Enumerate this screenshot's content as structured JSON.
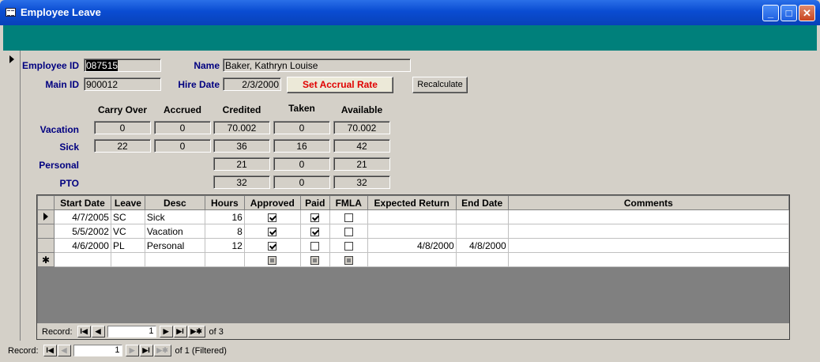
{
  "window": {
    "title": "Employee Leave",
    "min": "_",
    "max": "□",
    "close": "✕"
  },
  "labels": {
    "employee_id": "Employee ID",
    "name": "Name",
    "main_id": "Main ID",
    "hire_date": "Hire Date"
  },
  "fields": {
    "employee_id": "087515",
    "name": "Baker, Kathryn Louise",
    "main_id": "900012",
    "hire_date": "2/3/2000"
  },
  "buttons": {
    "set_accrual": "Set Accrual Rate",
    "recalculate": "Recalculate"
  },
  "balances": {
    "headers": [
      "Carry Over",
      "Accrued",
      "Credited",
      "Taken",
      "Available"
    ],
    "rows": [
      {
        "label": "Vacation",
        "values": [
          "0",
          "0",
          "70.002",
          "0",
          "70.002"
        ]
      },
      {
        "label": "Sick",
        "values": [
          "22",
          "0",
          "36",
          "16",
          "42"
        ]
      },
      {
        "label": "Personal",
        "values": [
          "",
          "",
          "21",
          "0",
          "21"
        ]
      },
      {
        "label": "PTO",
        "values": [
          "",
          "",
          "32",
          "0",
          "32"
        ]
      }
    ]
  },
  "leave_table": {
    "columns": [
      "Start Date",
      "Leave",
      "Desc",
      "Hours",
      "Approved",
      "Paid",
      "FMLA",
      "Expected Return",
      "End Date",
      "Comments"
    ],
    "rows": [
      {
        "start": "4/7/2005",
        "leave": "SC",
        "desc": "Sick",
        "hours": "16",
        "approved": true,
        "paid": true,
        "fmla": false,
        "expected": "",
        "end": "",
        "comments": ""
      },
      {
        "start": "5/5/2002",
        "leave": "VC",
        "desc": "Vacation",
        "hours": "8",
        "approved": true,
        "paid": true,
        "fmla": false,
        "expected": "",
        "end": "",
        "comments": ""
      },
      {
        "start": "4/6/2000",
        "leave": "PL",
        "desc": "Personal",
        "hours": "12",
        "approved": true,
        "paid": false,
        "fmla": false,
        "expected": "4/8/2000",
        "end": "4/8/2000",
        "comments": ""
      }
    ],
    "new_row_marker": "✱"
  },
  "sub_nav": {
    "label": "Record:",
    "current": "1",
    "of_text": "of  3"
  },
  "main_nav": {
    "label": "Record:",
    "current": "1",
    "of_text": "of  1 (Filtered)"
  },
  "nav_icons": {
    "first": "I◀",
    "prev": "◀",
    "next": "▶",
    "last": "▶I",
    "new": "▶✱"
  }
}
